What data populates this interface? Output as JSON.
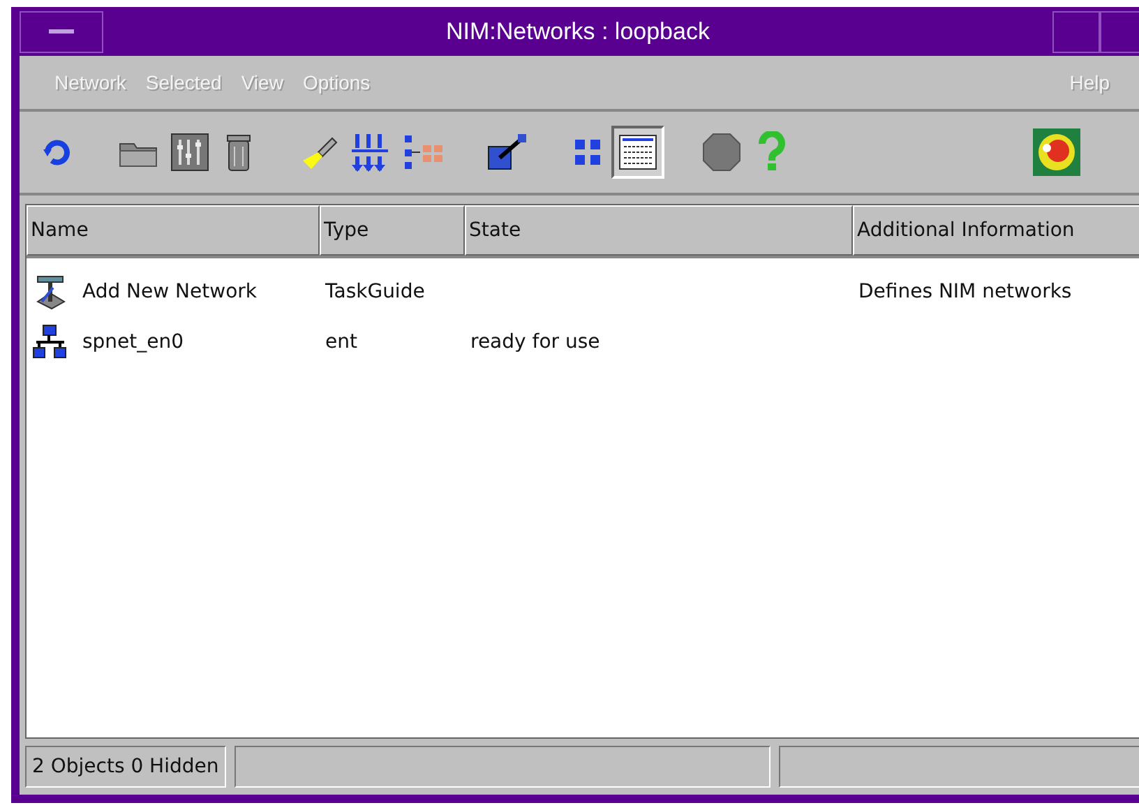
{
  "window": {
    "title": "NIM:Networks : loopback"
  },
  "menu": [
    "Network",
    "Selected",
    "View",
    "Options"
  ],
  "help_menu": "Help",
  "toolbar": {
    "view_buttons": [
      {
        "selected": false
      },
      {
        "selected": true
      }
    ]
  },
  "table": {
    "columns": [
      "Name",
      "Type",
      "State",
      "Additional Information"
    ],
    "rows": [
      {
        "name": "Add New Network",
        "type": "TaskGuide",
        "state": "",
        "info": "Defines NIM networks"
      },
      {
        "name": "spnet_en0",
        "type": "ent",
        "state": "ready for use",
        "info": ""
      }
    ]
  },
  "status_bar": {
    "text": "2 Objects 0 Hidden"
  }
}
